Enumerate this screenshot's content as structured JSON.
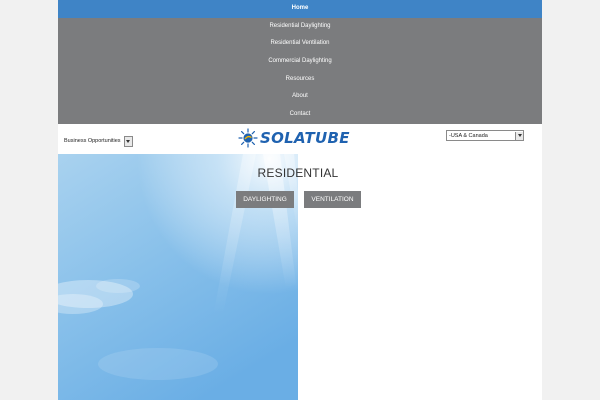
{
  "nav": {
    "items": [
      {
        "label": "Home",
        "active": true
      },
      {
        "label": "Residential Daylighting"
      },
      {
        "label": "Residential Ventilation"
      },
      {
        "label": "Commercial Daylighting"
      },
      {
        "label": "Resources"
      },
      {
        "label": "About"
      },
      {
        "label": "Contact"
      }
    ]
  },
  "header": {
    "business_select": {
      "value": "Business Opportunities"
    },
    "region_select": {
      "value": "-USA & Canada"
    },
    "logo_text": "SOLATUBE"
  },
  "main": {
    "heading": "RESIDENTIAL",
    "buttons": {
      "daylighting": "DAYLIGHTING",
      "ventilation": "VENTILATION"
    }
  },
  "colors": {
    "nav_bg": "#7b7c7e",
    "nav_active": "#3f84c6",
    "brand_blue": "#1f62b0",
    "button_bg": "#7b7c7e"
  }
}
